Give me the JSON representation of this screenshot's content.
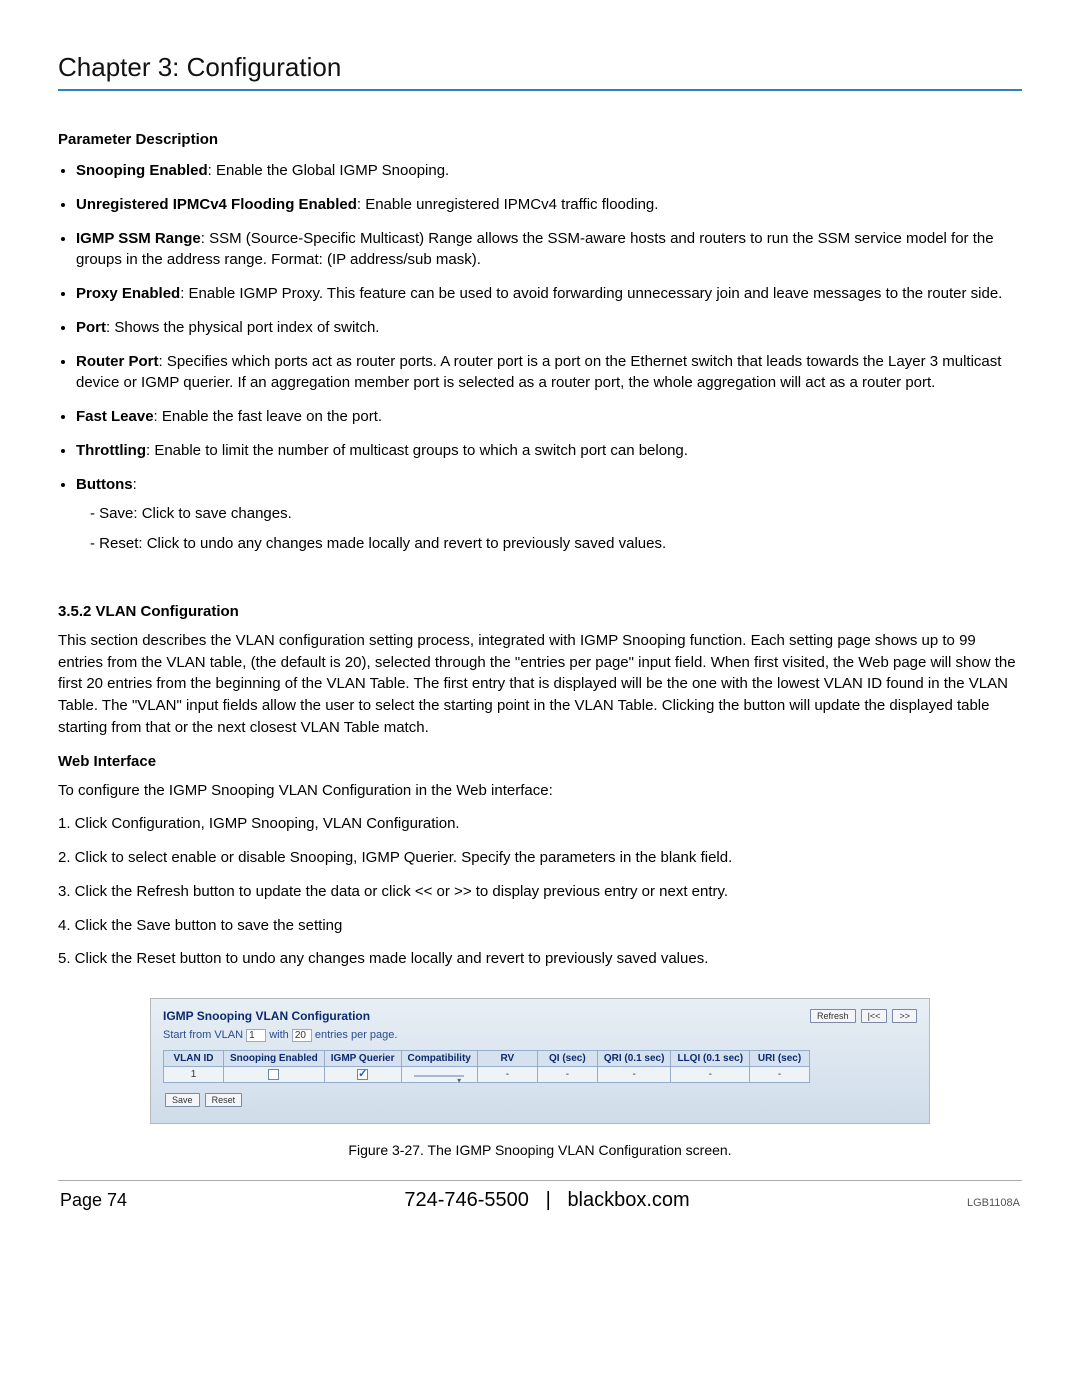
{
  "header": {
    "title": "Chapter 3: Configuration"
  },
  "params_heading": "Parameter Description",
  "params": [
    {
      "term": "Snooping Enabled",
      "desc": ": Enable the Global IGMP Snooping."
    },
    {
      "term": "Unregistered IPMCv4 Flooding Enabled",
      "desc": ": Enable unregistered IPMCv4 traffic flooding."
    },
    {
      "term": "IGMP SSM Range",
      "desc": ": SSM (Source-Specific Multicast) Range allows the SSM-aware hosts and routers to run the SSM service model for the groups in the address range. Format: (IP address/sub mask)."
    },
    {
      "term": "Proxy Enabled",
      "desc": ": Enable IGMP Proxy. This feature can be used to avoid forwarding unnecessary join and leave messages to the router side."
    },
    {
      "term": "Port",
      "desc": ": Shows the physical port index of switch."
    },
    {
      "term": "Router Port",
      "desc": ": Specifies which ports act as router ports. A router port is a port on the Ethernet switch that leads towards the Layer 3 multicast device or IGMP querier. If an aggregation member port is selected as a router port, the whole aggregation will act as a router port."
    },
    {
      "term": "Fast Leave",
      "desc": ": Enable the fast leave on the port."
    },
    {
      "term": "Throttling",
      "desc": ": Enable to limit the number of multicast groups to which a switch port can belong."
    },
    {
      "term": "Buttons",
      "desc": ":",
      "sub": [
        "Save: Click to save changes.",
        "Reset: Click to undo any changes made locally and revert to previously saved values."
      ]
    }
  ],
  "section": {
    "num_title": "3.5.2 VLAN Configuration",
    "intro": "This section describes the VLAN configuration setting process, integrated with IGMP Snooping function. Each setting page shows up to 99 entries from the VLAN table, (the default is 20), selected through the \"entries per page\" input field. When first visited, the Web page will show the first 20 entries from the beginning of the VLAN Table. The first entry that is displayed will be the one with the lowest VLAN ID found in the VLAN Table. The \"VLAN\" input fields allow the user to select the starting point in the VLAN Table. Clicking the button will update the displayed table starting from that or the next closest VLAN Table match.",
    "webif_head": "Web Interface",
    "webif_intro": "To configure the IGMP Snooping VLAN Configuration in the Web interface:",
    "steps": [
      "1. Click Configuration, IGMP Snooping, VLAN Configuration.",
      "2. Click to select enable or disable Snooping, IGMP Querier. Specify the parameters in the blank field.",
      "3. Click the Refresh button to update the data or click << or >> to display previous entry or next entry.",
      "4. Click the Save button to save the setting",
      "5. Click the Reset button to undo any changes made locally and revert to previously saved values."
    ]
  },
  "figure": {
    "title": "IGMP Snooping VLAN Configuration",
    "btn_refresh": "Refresh",
    "btn_prev": "|<<",
    "btn_next": ">>",
    "start_label": "Start from VLAN",
    "start_val": "1",
    "with_label": "with",
    "with_val": "20",
    "perpage_label": "entries per page.",
    "cols": [
      "VLAN ID",
      "Snooping Enabled",
      "IGMP Querier",
      "Compatibility",
      "RV",
      "QI (sec)",
      "QRI (0.1 sec)",
      "LLQI (0.1 sec)",
      "URI (sec)"
    ],
    "row": {
      "vlan_id": "1",
      "snoop_checked": false,
      "querier_checked": true,
      "compat": "",
      "rv": "-",
      "qi": "-",
      "qri": "-",
      "llqi": "-",
      "uri": "-"
    },
    "btn_save": "Save",
    "btn_reset": "Reset",
    "caption": "Figure 3-27. The IGMP Snooping VLAN Configuration screen."
  },
  "footer": {
    "page": "Page 74",
    "phone": "724-746-5500",
    "sep": "|",
    "site": "blackbox.com",
    "model": "LGB1108A"
  }
}
